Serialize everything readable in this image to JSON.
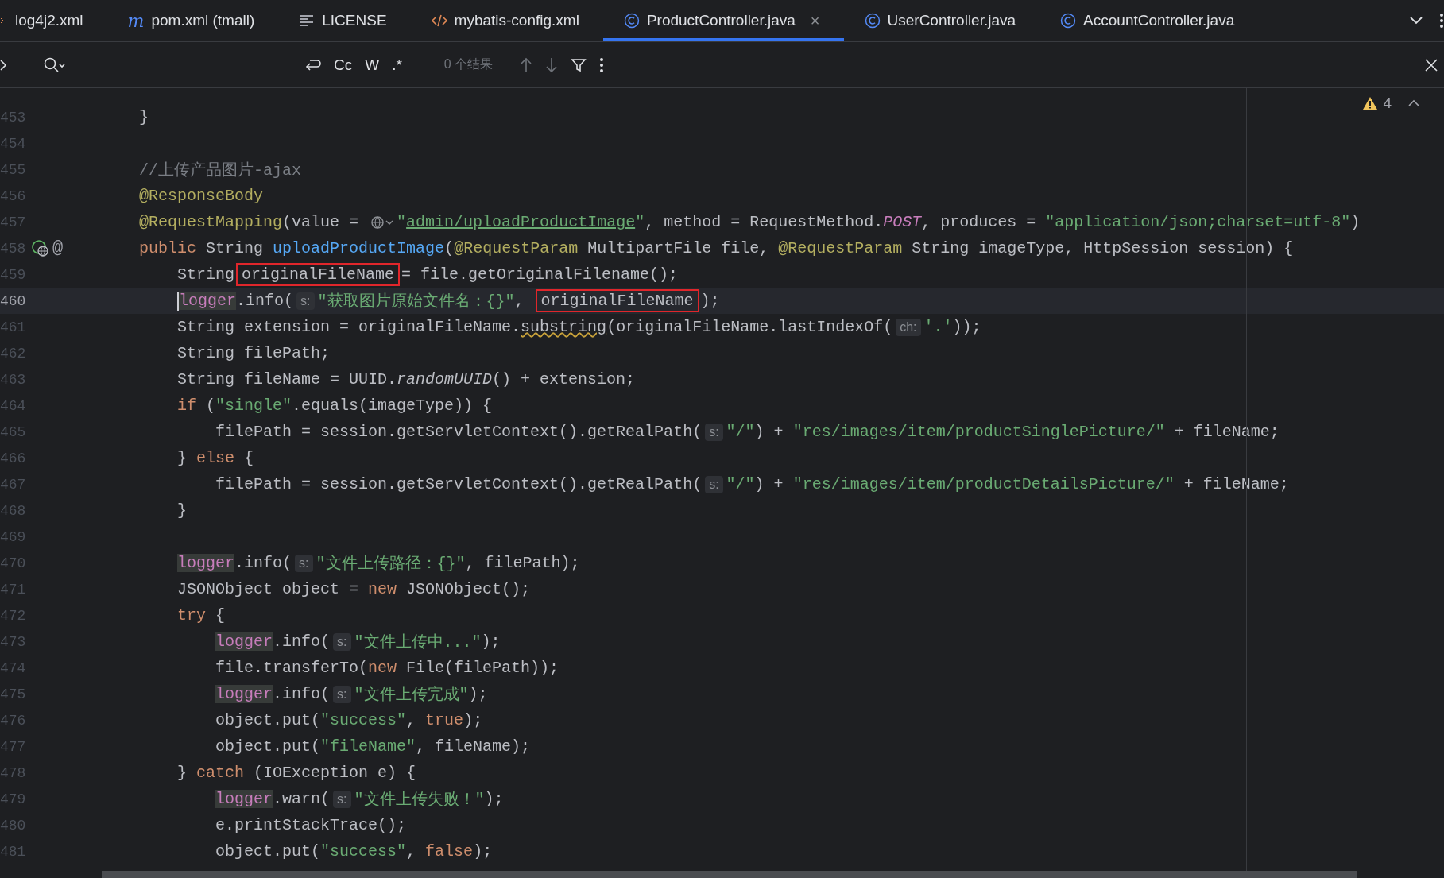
{
  "tabs": [
    {
      "label": "log4j2.xml",
      "kind": "xml",
      "selected": false
    },
    {
      "label": "pom.xml (tmall)",
      "kind": "maven",
      "glyph": "m",
      "selected": false
    },
    {
      "label": "LICENSE",
      "kind": "text",
      "selected": false
    },
    {
      "label": "mybatis-config.xml",
      "kind": "markup",
      "selected": false
    },
    {
      "label": "ProductController.java",
      "kind": "class",
      "selected": true,
      "close": "×"
    },
    {
      "label": "UserController.java",
      "kind": "class",
      "selected": false
    },
    {
      "label": "AccountController.java",
      "kind": "class",
      "selected": false
    }
  ],
  "search": {
    "options": [
      "Cc",
      "W",
      ".*"
    ],
    "results": "0 个结果"
  },
  "inspections": {
    "warnings": "4"
  },
  "lines": [
    {
      "number": "453",
      "current": false,
      "tokens": [
        {
          "kind": "text",
          "text": "    }"
        }
      ]
    },
    {
      "number": "454",
      "current": false
    },
    {
      "number": "455",
      "current": false,
      "tokens": [
        {
          "kind": "comment",
          "text": "    //上传产品图片-ajax"
        }
      ]
    },
    {
      "number": "456",
      "current": false,
      "tokens": [
        {
          "kind": "annotation",
          "text": "    @ResponseBody"
        }
      ]
    },
    {
      "number": "457",
      "current": false,
      "tokens": [
        {
          "kind": "annotation",
          "text": "    @RequestMapping"
        },
        {
          "kind": "text",
          "text": "(value = "
        },
        {
          "kind": "globe"
        },
        {
          "kind": "string",
          "text": "\""
        },
        {
          "kind": "link",
          "text": "admin/uploadProductImage"
        },
        {
          "kind": "string",
          "text": "\""
        },
        {
          "kind": "text",
          "text": ", method = RequestMethod."
        },
        {
          "kind": "constant",
          "text": "POST"
        },
        {
          "kind": "text",
          "text": ", produces = "
        },
        {
          "kind": "string",
          "text": "\"application/json;charset=utf-8\""
        },
        {
          "kind": "text",
          "text": ")"
        }
      ]
    },
    {
      "number": "458",
      "current": false,
      "gutter": {
        "kind": "endpoint",
        "glyph": "@"
      },
      "tokens": [
        {
          "kind": "keyword",
          "text": "    public"
        },
        {
          "kind": "text",
          "text": " String "
        },
        {
          "kind": "method",
          "text": "uploadProductImage"
        },
        {
          "kind": "text",
          "text": "("
        },
        {
          "kind": "annotation",
          "text": "@RequestParam"
        },
        {
          "kind": "text",
          "text": " MultipartFile file, "
        },
        {
          "kind": "annotation",
          "text": "@RequestParam"
        },
        {
          "kind": "text",
          "text": " String imageType, HttpSession session) {"
        }
      ]
    },
    {
      "number": "459",
      "current": false,
      "tokens": [
        {
          "kind": "text",
          "text": "        String"
        },
        {
          "kind": "boxed",
          "text": "originalFileName"
        },
        {
          "kind": "text",
          "text": "= file.getOriginalFilename();"
        }
      ]
    },
    {
      "number": "460",
      "current": true,
      "tokens": [
        {
          "kind": "field",
          "text": "        logger"
        },
        {
          "kind": "text",
          "text": ".info("
        },
        {
          "kind": "hint",
          "text": "s:"
        },
        {
          "kind": "string",
          "text": "\"获取图片原始文件名：{}\""
        },
        {
          "kind": "text",
          "text": ", "
        },
        {
          "kind": "boxed",
          "text": "originalFileName"
        },
        {
          "kind": "text",
          "text": ");"
        }
      ]
    },
    {
      "number": "461",
      "current": false,
      "tokens": [
        {
          "kind": "text",
          "text": "        String extension = originalFileName."
        },
        {
          "kind": "warning",
          "text": "substring"
        },
        {
          "kind": "text",
          "text": "(originalFileName.lastIndexOf("
        },
        {
          "kind": "hint",
          "text": "ch:"
        },
        {
          "kind": "string",
          "text": "'.'"
        },
        {
          "kind": "text",
          "text": "));"
        }
      ]
    },
    {
      "number": "462",
      "current": false,
      "tokens": [
        {
          "kind": "text",
          "text": "        String filePath;"
        }
      ]
    },
    {
      "number": "463",
      "current": false,
      "tokens": [
        {
          "kind": "text",
          "text": "        String fileName = UUID."
        },
        {
          "kind": "static",
          "text": "randomUUID"
        },
        {
          "kind": "text",
          "text": "() + extension;"
        }
      ]
    },
    {
      "number": "464",
      "current": false,
      "tokens": [
        {
          "kind": "keyword",
          "text": "        if"
        },
        {
          "kind": "text",
          "text": " ("
        },
        {
          "kind": "string",
          "text": "\"single\""
        },
        {
          "kind": "text",
          "text": ".equals(imageType)) {"
        }
      ]
    },
    {
      "number": "465",
      "current": false,
      "tokens": [
        {
          "kind": "text",
          "text": "            filePath = session.getServletContext().getRealPath("
        },
        {
          "kind": "hint",
          "text": "s:"
        },
        {
          "kind": "string",
          "text": "\"/\""
        },
        {
          "kind": "text",
          "text": ") + "
        },
        {
          "kind": "string",
          "text": "\"res/images/item/productSinglePicture/\""
        },
        {
          "kind": "text",
          "text": " + fileName;"
        }
      ]
    },
    {
      "number": "466",
      "current": false,
      "tokens": [
        {
          "kind": "text",
          "text": "        } "
        },
        {
          "kind": "keyword",
          "text": "else"
        },
        {
          "kind": "text",
          "text": " {"
        }
      ]
    },
    {
      "number": "467",
      "current": false,
      "tokens": [
        {
          "kind": "text",
          "text": "            filePath = session.getServletContext().getRealPath("
        },
        {
          "kind": "hint",
          "text": "s:"
        },
        {
          "kind": "string",
          "text": "\"/\""
        },
        {
          "kind": "text",
          "text": ") + "
        },
        {
          "kind": "string",
          "text": "\"res/images/item/productDetailsPicture/\""
        },
        {
          "kind": "text",
          "text": " + fileName;"
        }
      ]
    },
    {
      "number": "468",
      "current": false,
      "tokens": [
        {
          "kind": "text",
          "text": "        }"
        }
      ]
    },
    {
      "number": "469",
      "current": false
    },
    {
      "number": "470",
      "current": false,
      "tokens": [
        {
          "kind": "field",
          "text": "        logger"
        },
        {
          "kind": "text",
          "text": ".info("
        },
        {
          "kind": "hint",
          "text": "s:"
        },
        {
          "kind": "string",
          "text": "\"文件上传路径：{}\""
        },
        {
          "kind": "text",
          "text": ", filePath);"
        }
      ]
    },
    {
      "number": "471",
      "current": false,
      "tokens": [
        {
          "kind": "text",
          "text": "        JSONObject object = "
        },
        {
          "kind": "keyword",
          "text": "new"
        },
        {
          "kind": "text",
          "text": " JSONObject();"
        }
      ]
    },
    {
      "number": "472",
      "current": false,
      "tokens": [
        {
          "kind": "keyword",
          "text": "        try"
        },
        {
          "kind": "text",
          "text": " {"
        }
      ]
    },
    {
      "number": "473",
      "current": false,
      "tokens": [
        {
          "kind": "field",
          "text": "            logger"
        },
        {
          "kind": "text",
          "text": ".info("
        },
        {
          "kind": "hint",
          "text": "s:"
        },
        {
          "kind": "string",
          "text": "\"文件上传中...\""
        },
        {
          "kind": "text",
          "text": ");"
        }
      ]
    },
    {
      "number": "474",
      "current": false,
      "tokens": [
        {
          "kind": "text",
          "text": "            file.transferTo("
        },
        {
          "kind": "keyword",
          "text": "new"
        },
        {
          "kind": "text",
          "text": " File(filePath));"
        }
      ]
    },
    {
      "number": "475",
      "current": false,
      "tokens": [
        {
          "kind": "field",
          "text": "            logger"
        },
        {
          "kind": "text",
          "text": ".info("
        },
        {
          "kind": "hint",
          "text": "s:"
        },
        {
          "kind": "string",
          "text": "\"文件上传完成\""
        },
        {
          "kind": "text",
          "text": ");"
        }
      ]
    },
    {
      "number": "476",
      "current": false,
      "tokens": [
        {
          "kind": "text",
          "text": "            object.put("
        },
        {
          "kind": "string",
          "text": "\"success\""
        },
        {
          "kind": "text",
          "text": ", "
        },
        {
          "kind": "keyword",
          "text": "true"
        },
        {
          "kind": "text",
          "text": ");"
        }
      ]
    },
    {
      "number": "477",
      "current": false,
      "tokens": [
        {
          "kind": "text",
          "text": "            object.put("
        },
        {
          "kind": "string",
          "text": "\"fileName\""
        },
        {
          "kind": "text",
          "text": ", fileName);"
        }
      ]
    },
    {
      "number": "478",
      "current": false,
      "tokens": [
        {
          "kind": "text",
          "text": "        } "
        },
        {
          "kind": "keyword",
          "text": "catch"
        },
        {
          "kind": "text",
          "text": " (IOException e) {"
        }
      ]
    },
    {
      "number": "479",
      "current": false,
      "tokens": [
        {
          "kind": "field",
          "text": "            logger"
        },
        {
          "kind": "text",
          "text": ".warn("
        },
        {
          "kind": "hint",
          "text": "s:"
        },
        {
          "kind": "string",
          "text": "\"文件上传失败！\""
        },
        {
          "kind": "text",
          "text": ");"
        }
      ]
    },
    {
      "number": "480",
      "current": false,
      "tokens": [
        {
          "kind": "text",
          "text": "            e.printStackTrace();"
        }
      ]
    },
    {
      "number": "481",
      "current": false,
      "tokens": [
        {
          "kind": "text",
          "text": "            object.put("
        },
        {
          "kind": "string",
          "text": "\"success\""
        },
        {
          "kind": "text",
          "text": ", "
        },
        {
          "kind": "keyword",
          "text": "false"
        },
        {
          "kind": "text",
          "text": ");"
        }
      ]
    }
  ]
}
